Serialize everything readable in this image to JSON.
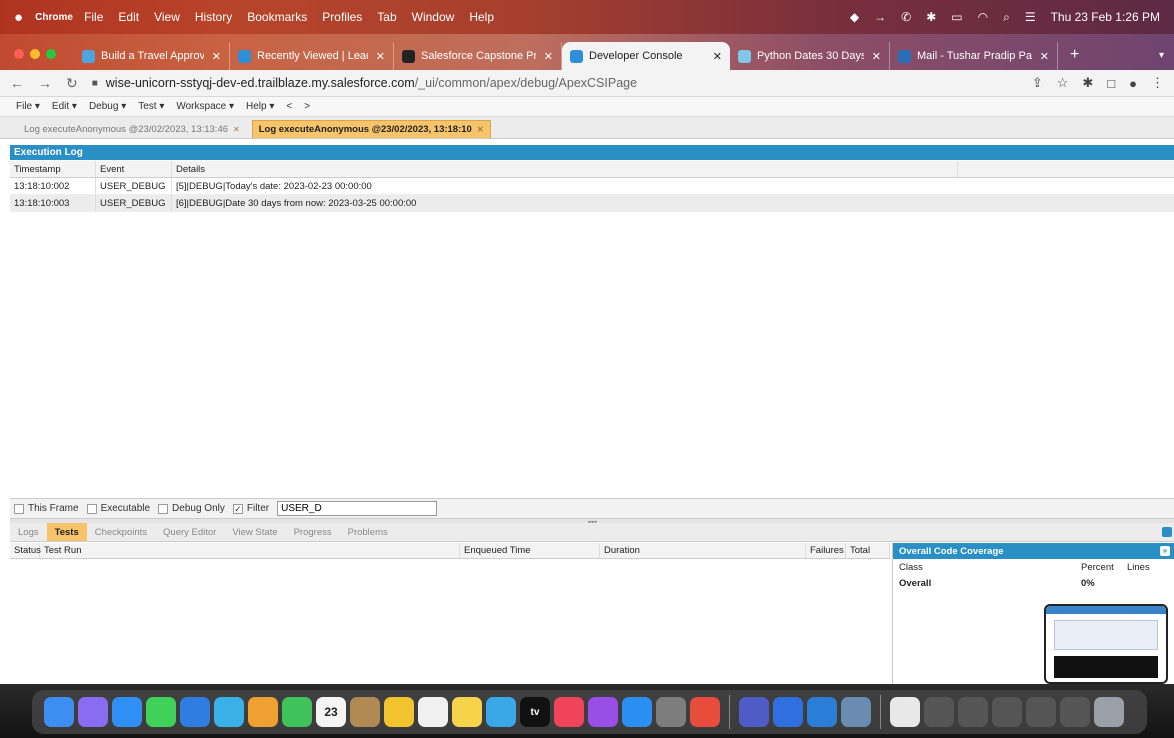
{
  "menubar": {
    "app": "Chrome",
    "items": [
      "File",
      "Edit",
      "View",
      "History",
      "Bookmarks",
      "Profiles",
      "Tab",
      "Window",
      "Help"
    ],
    "clock": "Thu 23 Feb  1:26 PM"
  },
  "tabs": [
    {
      "title": "Build a Travel Approval A",
      "color": "#4fa3e0"
    },
    {
      "title": "Recently Viewed | Leads",
      "color": "#2f8fd6"
    },
    {
      "title": "Salesforce Capstone Pro",
      "color": "#222222"
    },
    {
      "title": "Developer Console",
      "color": "#2f8fd6"
    },
    {
      "title": "Python Dates 30 Days",
      "color": "#7fc6e8"
    },
    {
      "title": "Mail - Tushar Pradip Pat",
      "color": "#2a6fb8"
    }
  ],
  "address": {
    "host": "wise-unicorn-sstyqj-dev-ed.trailblaze.my.salesforce.com",
    "path": "/_ui/common/apex/debug/ApexCSIPage"
  },
  "devconsole_menu": [
    "File ▾",
    "Edit ▾",
    "Debug ▾",
    "Test ▾",
    "Workspace ▾",
    "Help ▾",
    "<",
    ">"
  ],
  "log_tabs": [
    {
      "label": "Log executeAnonymous @23/02/2023, 13:13:46"
    },
    {
      "label": "Log executeAnonymous @23/02/2023, 13:18:10"
    }
  ],
  "execution_log": {
    "title": "Execution Log",
    "columns": [
      "Timestamp",
      "Event",
      "Details"
    ],
    "rows": [
      {
        "timestamp": "13:18:10:002",
        "event": "USER_DEBUG",
        "details": "[5]|DEBUG|Today's date: 2023-02-23 00:00:00"
      },
      {
        "timestamp": "13:18:10:003",
        "event": "USER_DEBUG",
        "details": "[6]|DEBUG|Date 30 days from now: 2023-03-25 00:00:00"
      }
    ]
  },
  "filters": {
    "this_frame": "This Frame",
    "executable": "Executable",
    "debug_only": "Debug Only",
    "filter": "Filter",
    "filter_value": "USER_D"
  },
  "bottom_tabs": [
    "Logs",
    "Tests",
    "Checkpoints",
    "Query Editor",
    "View State",
    "Progress",
    "Problems"
  ],
  "tests": {
    "columns": [
      "Status",
      "Test Run",
      "Enqueued Time",
      "Duration",
      "Failures",
      "Total"
    ]
  },
  "coverage": {
    "title": "Overall Code Coverage",
    "columns": [
      "Class",
      "Percent",
      "Lines"
    ],
    "rows": [
      {
        "class": "Overall",
        "percent": "0%",
        "lines": ""
      }
    ]
  },
  "dock": {
    "calendar_day": "23"
  }
}
